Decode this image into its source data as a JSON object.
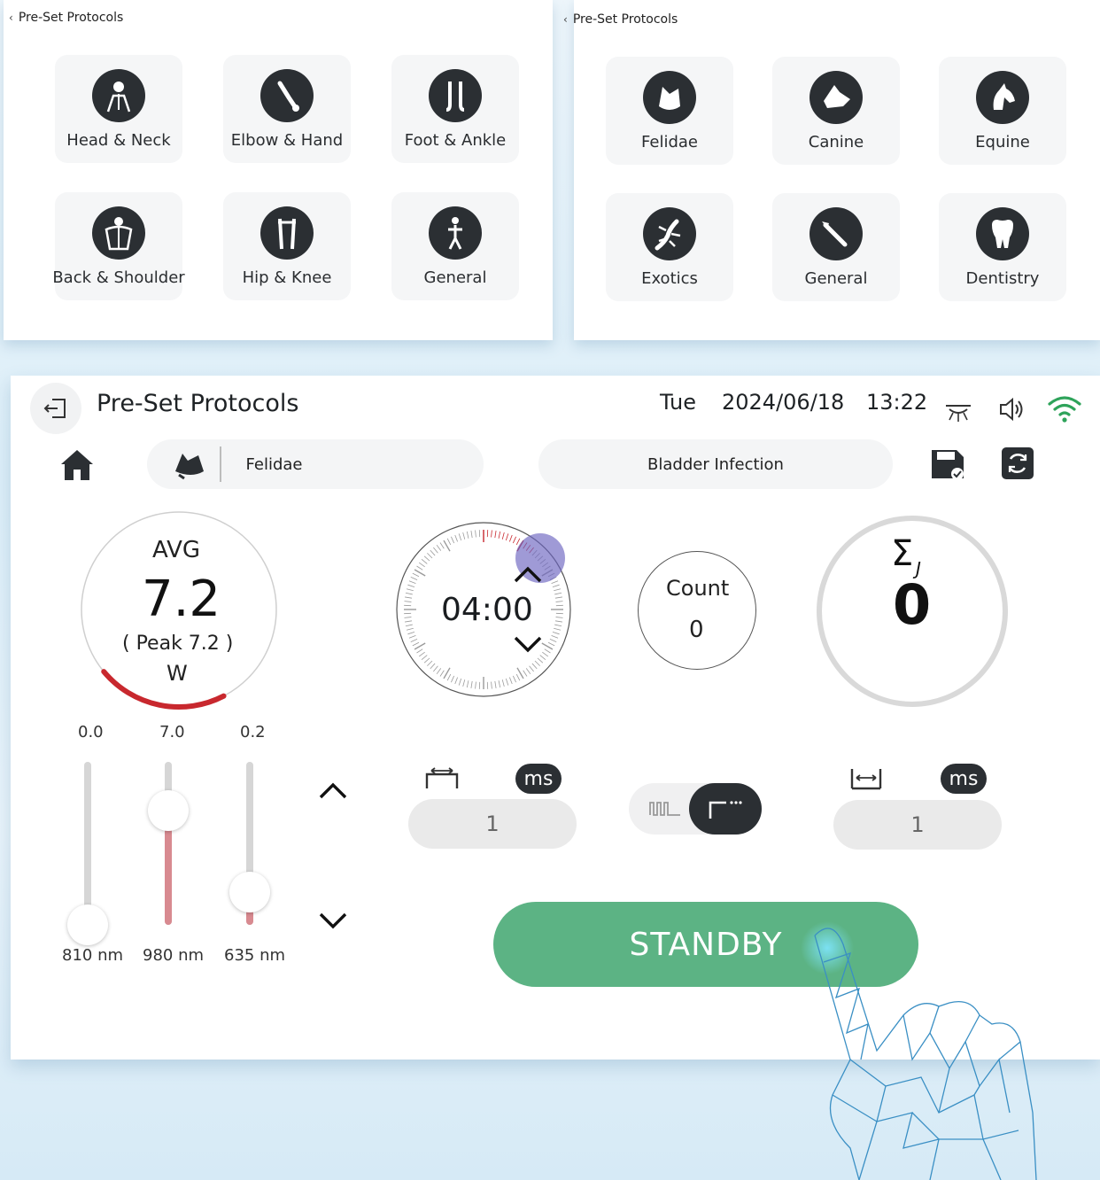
{
  "human_protocols": {
    "breadcrumb": "Pre-Set Protocols",
    "tiles": [
      {
        "label": "Head & Neck",
        "icon": "head-neck-icon"
      },
      {
        "label": "Elbow & Hand",
        "icon": "elbow-hand-icon"
      },
      {
        "label": "Foot & Ankle",
        "icon": "foot-ankle-icon"
      },
      {
        "label": "Back & Shoulder",
        "icon": "back-shoulder-icon"
      },
      {
        "label": "Hip & Knee",
        "icon": "hip-knee-icon"
      },
      {
        "label": "General",
        "icon": "body-icon"
      }
    ]
  },
  "vet_protocols": {
    "breadcrumb": "Pre-Set Protocols",
    "tiles": [
      {
        "label": "Felidae",
        "icon": "cat-icon"
      },
      {
        "label": "Canine",
        "icon": "dog-icon"
      },
      {
        "label": "Equine",
        "icon": "horse-icon"
      },
      {
        "label": "Exotics",
        "icon": "gecko-icon"
      },
      {
        "label": "General",
        "icon": "scalpel-icon"
      },
      {
        "label": "Dentistry",
        "icon": "tooth-icon"
      }
    ]
  },
  "header": {
    "title": "Pre-Set Protocols",
    "day": "Tue",
    "date": "2024/06/18",
    "time": "13:22"
  },
  "toolbar": {
    "category": "Felidae",
    "protocol": "Bladder Infection"
  },
  "power_gauge": {
    "label": "AVG",
    "value": "7.2",
    "peak": "( Peak  7.2 )",
    "unit": "W",
    "fraction": 0.36
  },
  "timer": {
    "value": "04:00"
  },
  "count": {
    "label": "Count",
    "value": "0"
  },
  "energy": {
    "symbol": "Σ",
    "sub": "J",
    "value": "0"
  },
  "wavelengths": [
    {
      "label": "810 nm",
      "value": "0.0",
      "fraction": 0.0
    },
    {
      "label": "980 nm",
      "value": "7.0",
      "fraction": 0.7
    },
    {
      "label": "635 nm",
      "value": "0.2",
      "fraction": 0.2
    }
  ],
  "pulse": {
    "on_value": "1",
    "on_unit": "ms",
    "off_value": "1",
    "off_unit": "ms"
  },
  "action": {
    "standby_label": "STANDBY"
  },
  "colors": {
    "accent_green": "#5cb384",
    "gauge_red": "#c8282e",
    "dark_icon": "#2b2f33",
    "wifi_green": "#2ea35a"
  }
}
